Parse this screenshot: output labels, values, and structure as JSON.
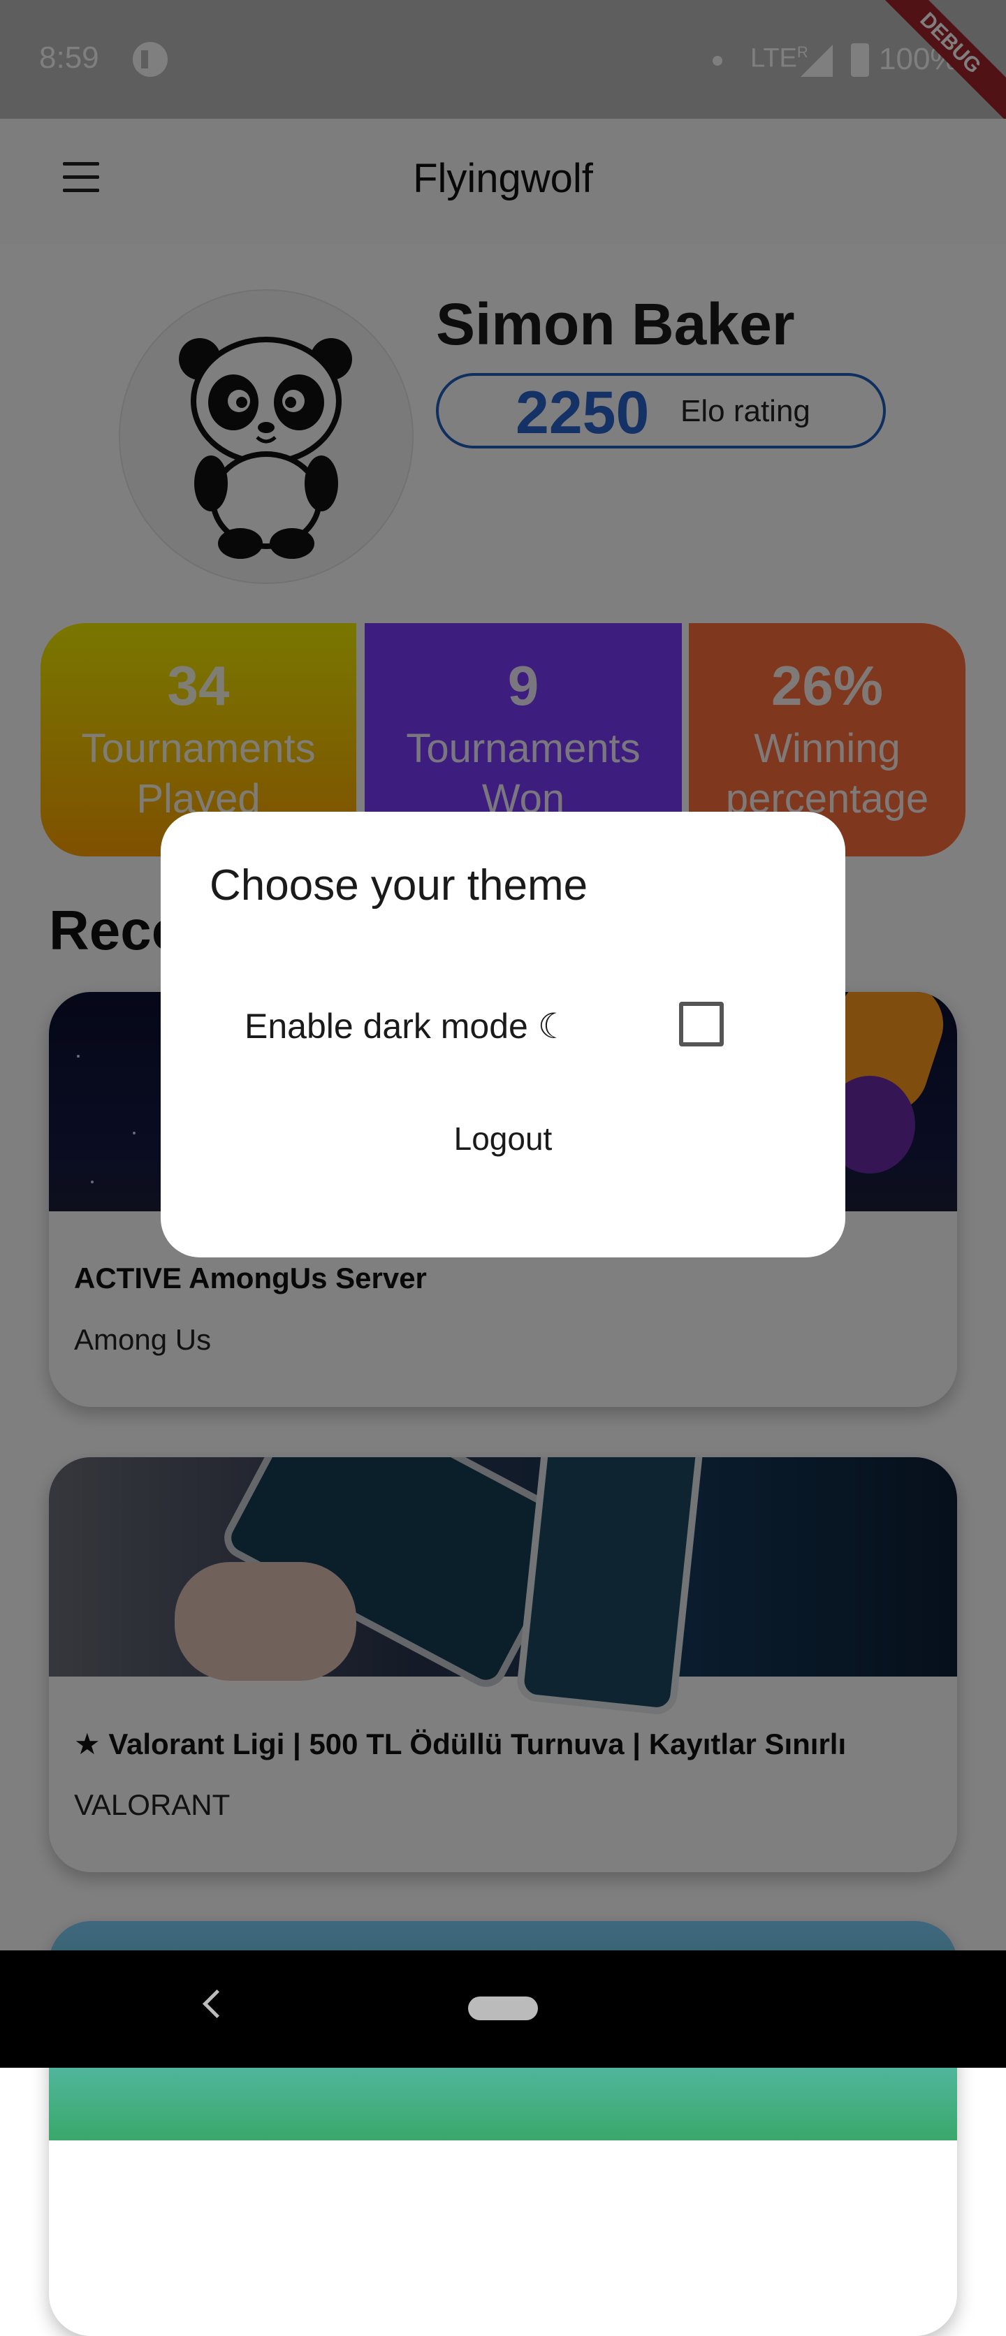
{
  "status_bar": {
    "time": "8:59",
    "network": "LTE",
    "roaming": "R",
    "battery": "100%",
    "debug_banner": "DEBUG"
  },
  "app_bar": {
    "title": "Flyingwolf",
    "menu_icon": "hamburger-menu-icon"
  },
  "profile": {
    "name": "Simon Baker",
    "elo_value": "2250",
    "elo_label": "Elo rating",
    "avatar": "panda-avatar"
  },
  "stats": [
    {
      "value": "34",
      "label_line1": "Tournaments",
      "label_line2": "Played",
      "color_from": "#f2ee00",
      "color_to": "#ffa100"
    },
    {
      "value": "9",
      "label_line1": "Tournaments",
      "label_line2": "Won",
      "color": "#7a3cff"
    },
    {
      "value": "26%",
      "label_line1": "Winning",
      "label_line2": "percentage",
      "color": "#ff6f3c"
    }
  ],
  "section_title": "Recommended for you",
  "tournaments": [
    {
      "title": "ACTIVE AmongUs Server",
      "game": "Among Us"
    },
    {
      "title": "★ Valorant Ligi | 500 TL Ödüllü Turnuva | Kayıtlar Sınırlı",
      "game": "VALORANT"
    },
    {
      "title": "",
      "game": ""
    }
  ],
  "dialog": {
    "title": "Choose your theme",
    "dark_mode_label": "Enable dark mode ☾",
    "dark_mode_checked": false,
    "logout_label": "Logout"
  },
  "colors": {
    "accent_blue": "#2a64cf",
    "scrim": "rgba(0,0,0,0.5)"
  }
}
